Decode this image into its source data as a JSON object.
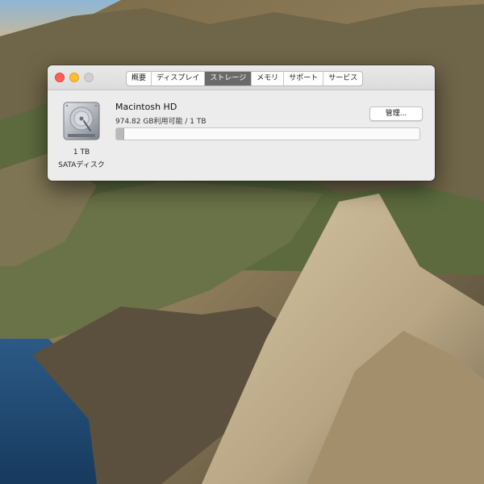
{
  "window": {
    "tabs": [
      {
        "label": "概要",
        "active": false
      },
      {
        "label": "ディスプレイ",
        "active": false
      },
      {
        "label": "ストレージ",
        "active": true
      },
      {
        "label": "メモリ",
        "active": false
      },
      {
        "label": "サポート",
        "active": false
      },
      {
        "label": "サービス",
        "active": false
      }
    ]
  },
  "storage": {
    "disk_name": "Macintosh HD",
    "disk_usage": "974.82 GB利用可能 / 1 TB",
    "manage_label": "管理...",
    "disk_size": "1 TB",
    "disk_type": "SATAディスク",
    "used_fraction": 0.025,
    "bar_color": "#b9b9b9",
    "disk_icon": "hard-drive-icon"
  }
}
